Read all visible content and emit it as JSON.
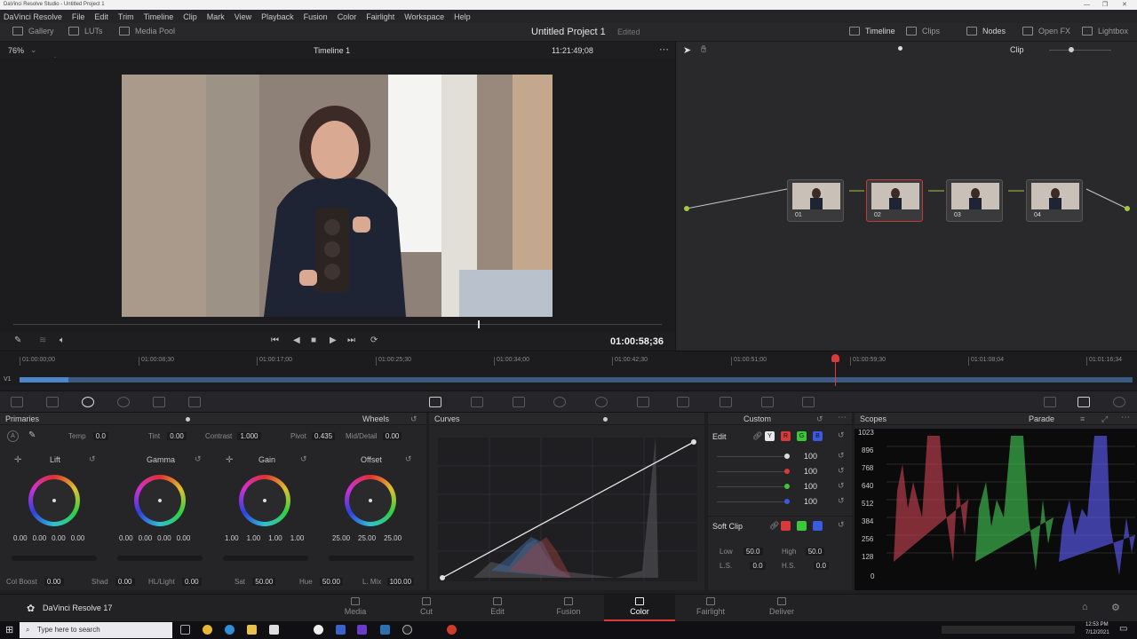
{
  "window": {
    "title": "DaVinci Resolve Studio - Untitled Project 1"
  },
  "menu": [
    "DaVinci Resolve",
    "File",
    "Edit",
    "Trim",
    "Timeline",
    "Clip",
    "Mark",
    "View",
    "Playback",
    "Fusion",
    "Color",
    "Fairlight",
    "Workspace",
    "Help"
  ],
  "toolbar": {
    "gallery": "Gallery",
    "luts": "LUTs",
    "media_pool": "Media Pool",
    "project_title": "Untitled Project 1",
    "edited": "Edited",
    "timeline_btn": "Timeline",
    "clips_btn": "Clips",
    "nodes_btn": "Nodes",
    "openfx_btn": "Open FX",
    "lightbox_btn": "Lightbox"
  },
  "viewer": {
    "zoom": "76%",
    "timeline_name": "Timeline 1",
    "timecode_top": "11:21:49;08",
    "timecode_current": "01:00:58;36",
    "clip_mode": "Clip"
  },
  "nodes": [
    {
      "label": "01",
      "selected": false
    },
    {
      "label": "02",
      "selected": true
    },
    {
      "label": "03",
      "selected": false
    },
    {
      "label": "04",
      "selected": false
    }
  ],
  "timeline": {
    "track": "V1",
    "ticks": [
      "01:00:00;00",
      "01:00:08;30",
      "01:00:17;00",
      "01:00:25;30",
      "01:00:34;00",
      "01:00:42;30",
      "01:00:51;00",
      "01:00:59;30",
      "01:01:08;04",
      "01:01:16;34"
    ]
  },
  "primaries": {
    "title": "Primaries",
    "mode": "Wheels",
    "temp_label": "Temp",
    "temp": "0.0",
    "tint_label": "Tint",
    "tint": "0.00",
    "contrast_label": "Contrast",
    "contrast": "1.000",
    "pivot_label": "Pivot",
    "pivot": "0.435",
    "middetail_label": "Mid/Detail",
    "middetail": "0.00",
    "wheels": [
      {
        "name": "Lift",
        "values": [
          "0.00",
          "0.00",
          "0.00",
          "0.00"
        ]
      },
      {
        "name": "Gamma",
        "values": [
          "0.00",
          "0.00",
          "0.00",
          "0.00"
        ]
      },
      {
        "name": "Gain",
        "values": [
          "1.00",
          "1.00",
          "1.00",
          "1.00"
        ]
      },
      {
        "name": "Offset",
        "values": [
          "25.00",
          "25.00",
          "25.00"
        ]
      }
    ],
    "colboost_label": "Col Boost",
    "colboost": "0.00",
    "shad_label": "Shad",
    "shad": "0.00",
    "hilight_label": "HL/Light",
    "hilight": "0.00",
    "sat_label": "Sat",
    "sat": "50.00",
    "hue_label": "Hue",
    "hue": "50.00",
    "lmix_label": "L. Mix",
    "lmix": "100.00"
  },
  "curves": {
    "title": "Curves",
    "mode": "Custom"
  },
  "custom": {
    "edit_label": "Edit",
    "channels": [
      "Y",
      "R",
      "G",
      "B"
    ],
    "levels": [
      "100",
      "100",
      "100",
      "100"
    ],
    "softclip_label": "Soft Clip",
    "low_label": "Low",
    "low": "50.0",
    "high_label": "High",
    "high": "50.0",
    "ls_label": "L.S.",
    "ls": "0.0",
    "hs_label": "H.S.",
    "hs": "0.0"
  },
  "scopes": {
    "title": "Scopes",
    "mode": "Parade",
    "scale": [
      "1023",
      "896",
      "768",
      "640",
      "512",
      "384",
      "256",
      "128",
      "0"
    ]
  },
  "pages": {
    "app_name": "DaVinci Resolve 17",
    "items": [
      "Media",
      "Cut",
      "Edit",
      "Fusion",
      "Color",
      "Fairlight",
      "Deliver"
    ],
    "active": "Color"
  },
  "taskbar": {
    "search_placeholder": "Type here to search",
    "time": "12:53 PM",
    "date": "7/12/2021"
  },
  "colors": {
    "accent_red": "#d93b3b",
    "active_page": "#ffffff",
    "panel_bg": "#252528"
  }
}
